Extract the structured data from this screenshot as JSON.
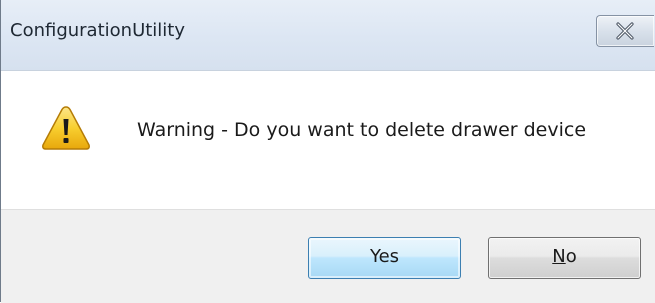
{
  "window": {
    "title": "ConfigurationUtility"
  },
  "dialog": {
    "icon": "warning-icon",
    "message": "Warning - Do you want to delete drawer device"
  },
  "buttons": {
    "yes_label": "Yes",
    "no_label_mnemonic": "N",
    "no_label_rest": "o"
  },
  "colors": {
    "titlebar": "#dce6f3",
    "footer": "#f0f0f0",
    "default_button_border": "#3c7fb1",
    "warning_yellow": "#f6c51b"
  }
}
